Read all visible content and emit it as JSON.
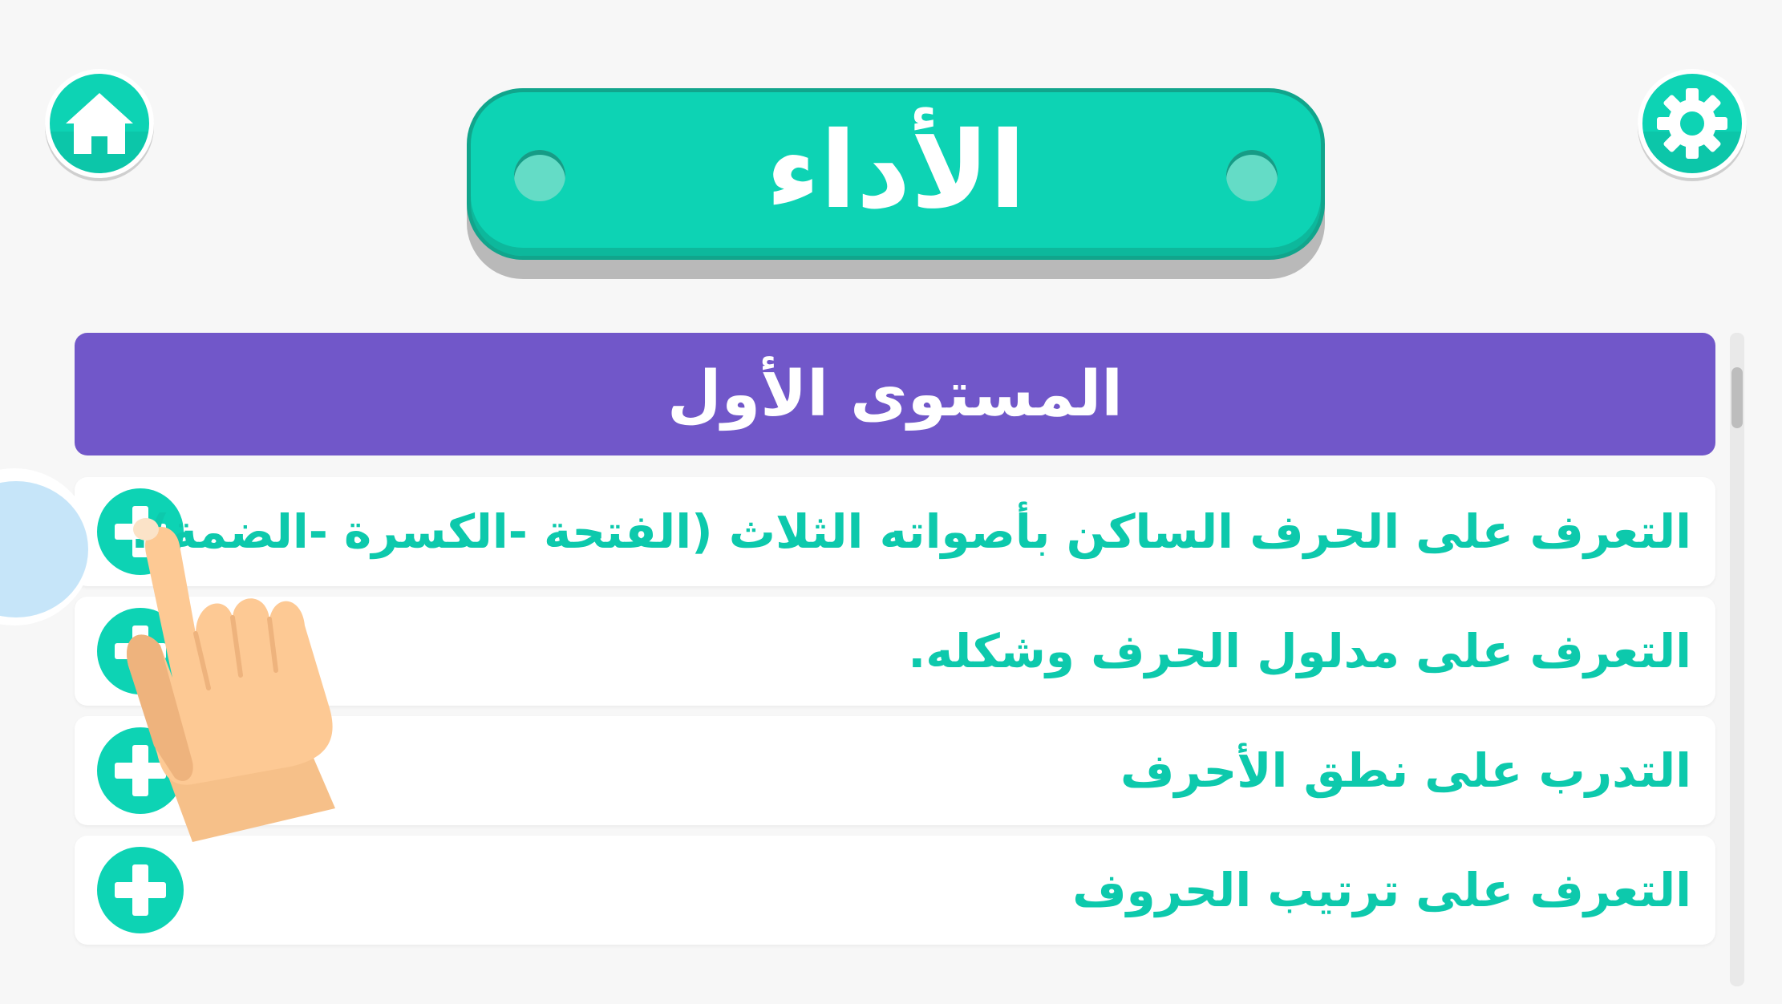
{
  "header": {
    "title": "الأداء",
    "home_icon": "home-icon",
    "settings_icon": "gear-icon"
  },
  "level": {
    "title": "المستوى الأول"
  },
  "lessons": [
    {
      "label": "التعرف على الحرف الساكن  بأصواته الثلاث (الفتحة -الكسرة -الضمة).",
      "icon": "plus-icon"
    },
    {
      "label": "التعرف على مدلول الحرف وشكله.",
      "icon": "plus-icon"
    },
    {
      "label": "التدرب على نطق الأحرف",
      "icon": "plus-icon"
    },
    {
      "label": "التعرف على  ترتيب الحروف",
      "icon": "plus-icon"
    }
  ],
  "hint": {
    "icon": "pointing-hand-icon"
  },
  "colors": {
    "accent": "#0dd3b4",
    "level_header": "#7157c9",
    "lesson_text": "#0dc9ac",
    "background": "#f7f7f7"
  }
}
